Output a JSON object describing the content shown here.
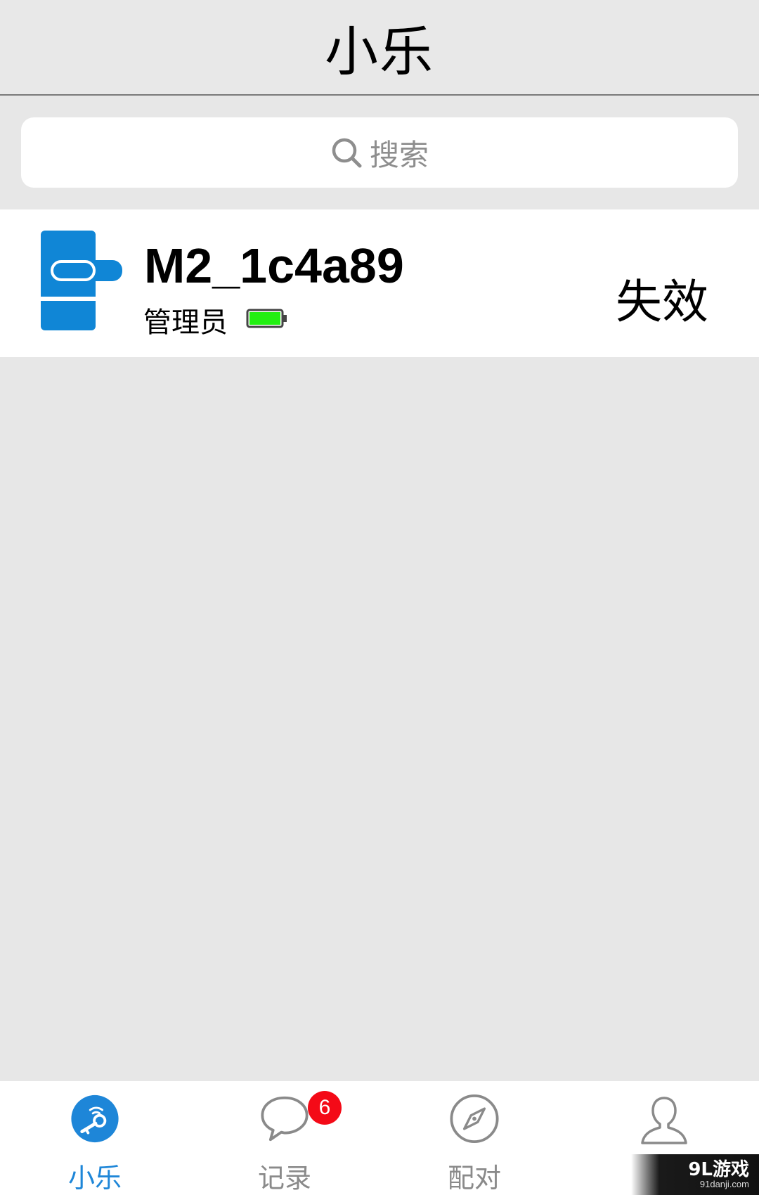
{
  "header": {
    "title": "小乐"
  },
  "search": {
    "placeholder": "搜索"
  },
  "device": {
    "name": "M2_1c4a89",
    "role": "管理员",
    "status": "失效",
    "battery_level": 1.0,
    "colors": {
      "lock_icon": "#1086d6",
      "battery_fill": "#22ee11"
    }
  },
  "tabs": [
    {
      "label": "小乐",
      "icon": "lock-key-icon",
      "active": true
    },
    {
      "label": "记录",
      "icon": "chat-bubble-icon",
      "badge": "6"
    },
    {
      "label": "配对",
      "icon": "compass-icon"
    },
    {
      "label": "",
      "icon": "user-icon"
    }
  ],
  "watermark": {
    "main": "9L游戏",
    "sub": "91danji.com"
  },
  "colors": {
    "accent": "#1e86d8",
    "badge": "#f40a17",
    "background": "#e7e7e7"
  }
}
